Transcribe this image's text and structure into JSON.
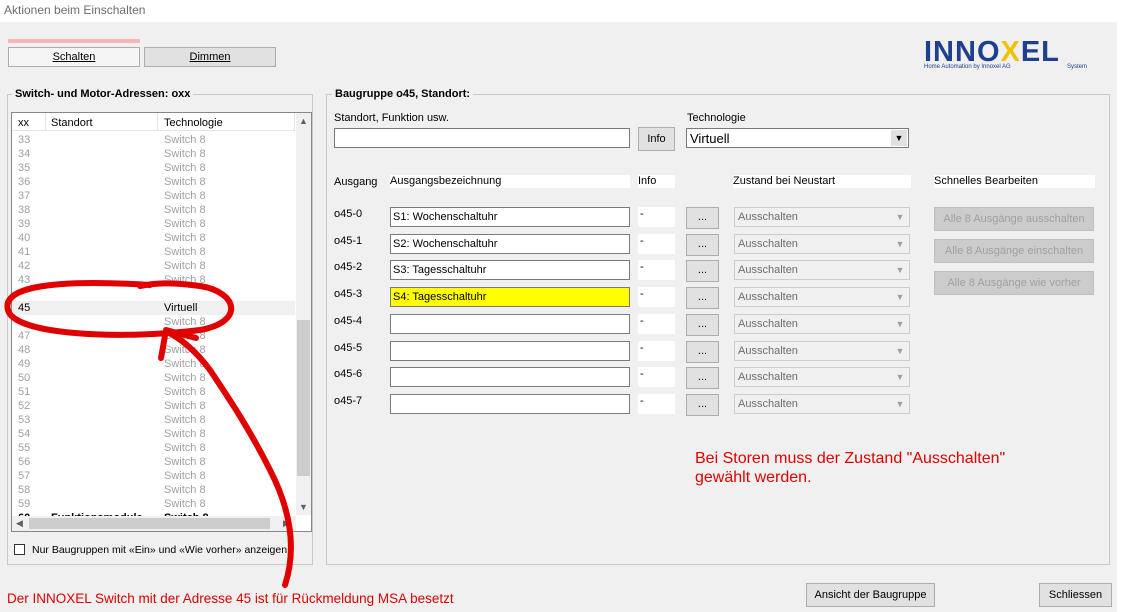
{
  "window": {
    "title": "Aktionen beim Einschalten"
  },
  "tabs": [
    {
      "label": "Schalten",
      "selected": true
    },
    {
      "label": "Dimmen",
      "selected": false
    }
  ],
  "logo": {
    "brand_left": "INNO",
    "brand_x": "X",
    "brand_right": "EL",
    "tagline": "Home Automation by Innoxel AG",
    "system": "System"
  },
  "left_panel": {
    "title": "Switch- und Motor-Adressen: oxx",
    "columns": [
      "xx",
      "Standort",
      "Technologie"
    ],
    "rows": [
      {
        "xx": "33",
        "standort": "",
        "tech": "Switch 8"
      },
      {
        "xx": "34",
        "standort": "",
        "tech": "Switch 8"
      },
      {
        "xx": "35",
        "standort": "",
        "tech": "Switch 8"
      },
      {
        "xx": "36",
        "standort": "",
        "tech": "Switch 8"
      },
      {
        "xx": "37",
        "standort": "",
        "tech": "Switch 8"
      },
      {
        "xx": "38",
        "standort": "",
        "tech": "Switch 8"
      },
      {
        "xx": "39",
        "standort": "",
        "tech": "Switch 8"
      },
      {
        "xx": "40",
        "standort": "",
        "tech": "Switch 8"
      },
      {
        "xx": "41",
        "standort": "",
        "tech": "Switch 8"
      },
      {
        "xx": "42",
        "standort": "",
        "tech": "Switch 8"
      },
      {
        "xx": "43",
        "standort": "",
        "tech": "Switch 8"
      },
      {
        "xx": "",
        "standort": "",
        "tech": ""
      },
      {
        "xx": "45",
        "standort": "",
        "tech": "Virtuell",
        "selected": true
      },
      {
        "xx": "",
        "standort": "",
        "tech": "Switch 8"
      },
      {
        "xx": "47",
        "standort": "",
        "tech": "Switch 8"
      },
      {
        "xx": "48",
        "standort": "",
        "tech": "Switch 8"
      },
      {
        "xx": "49",
        "standort": "",
        "tech": "Switch 8"
      },
      {
        "xx": "50",
        "standort": "",
        "tech": "Switch 8"
      },
      {
        "xx": "51",
        "standort": "",
        "tech": "Switch 8"
      },
      {
        "xx": "52",
        "standort": "",
        "tech": "Switch 8"
      },
      {
        "xx": "53",
        "standort": "",
        "tech": "Switch 8"
      },
      {
        "xx": "54",
        "standort": "",
        "tech": "Switch 8"
      },
      {
        "xx": "55",
        "standort": "",
        "tech": "Switch 8"
      },
      {
        "xx": "56",
        "standort": "",
        "tech": "Switch 8"
      },
      {
        "xx": "57",
        "standort": "",
        "tech": "Switch 8"
      },
      {
        "xx": "58",
        "standort": "",
        "tech": "Switch 8"
      },
      {
        "xx": "59",
        "standort": "",
        "tech": "Switch 8"
      },
      {
        "xx": "60",
        "standort": "Funktionsmodule",
        "tech": "Switch 8",
        "bold": true
      }
    ],
    "checkbox_label": "Nur Baugruppen mit «Ein» und «Wie vorher» anzeigen",
    "checkbox_checked": false
  },
  "right_panel": {
    "title": "Baugruppe o45, Standort:",
    "standort_label": "Standort, Funktion usw.",
    "standort_value": "",
    "info_button": "Info",
    "technologie_label": "Technologie",
    "technologie_value": "Virtuell",
    "col_ausgang": "Ausgang",
    "col_bezeichnung": "Ausgangsbezeichnung",
    "col_info": "Info",
    "col_zustand": "Zustand bei Neustart",
    "col_schnell": "Schnelles Bearbeiten",
    "outputs": [
      {
        "id": "o45-0",
        "name": "S1: Wochenschaltuhr",
        "info": "-",
        "zustand": "Ausschalten",
        "highlight": false
      },
      {
        "id": "o45-1",
        "name": "S2: Wochenschaltuhr",
        "info": "-",
        "zustand": "Ausschalten",
        "highlight": false
      },
      {
        "id": "o45-2",
        "name": "S3: Tagesschaltuhr",
        "info": "-",
        "zustand": "Ausschalten",
        "highlight": false
      },
      {
        "id": "o45-3",
        "name": "S4: Tagesschaltuhr",
        "info": "-",
        "zustand": "Ausschalten",
        "highlight": true
      },
      {
        "id": "o45-4",
        "name": "",
        "info": "-",
        "zustand": "Ausschalten",
        "highlight": false
      },
      {
        "id": "o45-5",
        "name": "",
        "info": "-",
        "zustand": "Ausschalten",
        "highlight": false
      },
      {
        "id": "o45-6",
        "name": "",
        "info": "-",
        "zustand": "Ausschalten",
        "highlight": false
      },
      {
        "id": "o45-7",
        "name": "",
        "info": "-",
        "zustand": "Ausschalten",
        "highlight": false
      }
    ],
    "dots_label": "...",
    "quick_buttons": [
      "Alle 8 Ausgänge ausschalten",
      "Alle 8 Ausgänge einschalten",
      "Alle 8 Ausgänge wie vorher"
    ],
    "note_line1": "Bei Storen muss der Zustand \"Ausschalten\"",
    "note_line2": "gewählt werden."
  },
  "footer": {
    "note": "Der INNOXEL Switch mit der Adresse 45 ist für Rückmeldung MSA besetzt",
    "view_button": "Ansicht der Baugruppe",
    "close_button": "Schliessen"
  },
  "colors": {
    "highlight": "#ffff00",
    "annotation_red": "#e00000",
    "logo_blue": "#1f3f8f",
    "logo_yellow": "#f2c200"
  }
}
